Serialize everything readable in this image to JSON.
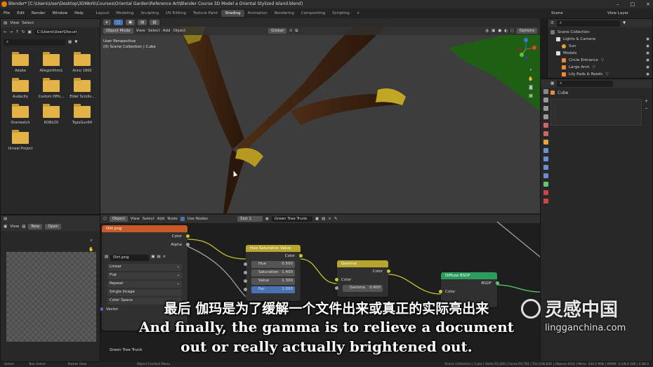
{
  "window": {
    "title": "Blender* [C:\\Users\\User\\Desktop\\3DWork\\Courses\\Oriental Garden\\Reference Art\\Blender Course 3D Model a Oriental Stylized Island.blend]",
    "controls": [
      "–",
      "□",
      "×"
    ]
  },
  "menu": [
    "File",
    "Edit",
    "Render",
    "Window",
    "Help"
  ],
  "workspaces": [
    "Layout",
    "Modeling",
    "Sculpting",
    "UV Editing",
    "Texture Paint",
    "Shading",
    "Animation",
    "Rendering",
    "Compositing",
    "Scripting"
  ],
  "active_workspace": "Shading",
  "scene": {
    "label": "Scene",
    "view_layer": "View Layer"
  },
  "file_browser": {
    "menu": [
      "View",
      "Select"
    ],
    "path": "C:\\Users\\User\\Docum...",
    "folders": [
      "Adobe",
      "Allegorithmic",
      "Anno 1800",
      "Audacity",
      "Custom Offic...",
      "Elder Scrolls...",
      "Overwatch",
      "ROBLOX",
      "TopoGun64",
      "Unreal Project"
    ],
    "folder_color": "#e3b348"
  },
  "viewport": {
    "mode": "Object Mode",
    "menu": [
      "View",
      "Select",
      "Add",
      "Object"
    ],
    "orientation": "Global",
    "options": "Options",
    "overlay_line1": "User Perspective",
    "overlay_line2": "(0) Scene Collection | Cube"
  },
  "outliner": {
    "title": "Scene Collection",
    "items": [
      {
        "label": "Lights & Camera",
        "indent": 1
      },
      {
        "label": "Sun",
        "indent": 2
      },
      {
        "label": "Models",
        "indent": 1
      },
      {
        "label": "Circle Entrance",
        "indent": 2
      },
      {
        "label": "Large Arch",
        "indent": 2
      },
      {
        "label": "Lily Pads & Reeds",
        "indent": 2
      }
    ]
  },
  "properties": {
    "object_name": "Cube"
  },
  "image_editor": {
    "view": "View",
    "new": "New",
    "open": "Open"
  },
  "node_editor": {
    "object": "Object",
    "menu": [
      "View",
      "Select",
      "Add",
      "Node"
    ],
    "use_nodes": "Use Nodes",
    "slot": "Slot 1",
    "material": "Green Tree Trunk",
    "footer": "Green Tree Trunk",
    "image_node": {
      "title": "Dirt.png",
      "outputs": [
        "Color",
        "Alpha"
      ],
      "image": "Dirt.png",
      "interpolation": "Linear",
      "projection": "Flat",
      "extension": "Repeat",
      "source": "Single Image",
      "color_space": "Color Space",
      "vector": "Vector"
    },
    "hsv_node": {
      "title": "Hue Saturation Value",
      "output": "Color",
      "rows": [
        {
          "label": "Hue",
          "value": "0.500"
        },
        {
          "label": "Saturation",
          "value": "1.400"
        },
        {
          "label": "Value",
          "value": "1.300"
        },
        {
          "label": "Fac",
          "value": "1.000"
        }
      ]
    },
    "gamma_node": {
      "title": "Gamma",
      "output": "Color",
      "input": "Color",
      "gamma_label": "Gamma",
      "gamma_value": "0.600"
    },
    "bsdf_node": {
      "title": "Diffuse BSDF",
      "output": "BSDF",
      "input": "Color"
    }
  },
  "subtitles": {
    "chinese": "最后 伽玛是为了缓解一个文件出来或真正的实际亮出来",
    "english_line1": "And finally, the gamma is to relieve a document",
    "english_line2": "out or really actually brightened out."
  },
  "watermark": {
    "brand": "灵感中国",
    "url": "lingganchina.com"
  },
  "statusbar": {
    "left": [
      "Select",
      "Box Select",
      "Rotate View",
      "Object Context Menu"
    ],
    "right": "Scene Collection | Cube | Verts:55,426 | Faces:59,781 | Tris:108,830 | Objects:0/16 | Mem: 340.5 MiB | VRAM: 4.1/8.0 GiB | 2.80.0"
  },
  "colors": {
    "accent": "#4772b3",
    "texture_header": "#c75a27",
    "color_header": "#b7a52d",
    "shader_header": "#2b9b5e",
    "socket_yellow": "#c7c729",
    "socket_grey": "#a1a1a1",
    "socket_green": "#5ccc6b",
    "socket_purple": "#6363c7"
  }
}
